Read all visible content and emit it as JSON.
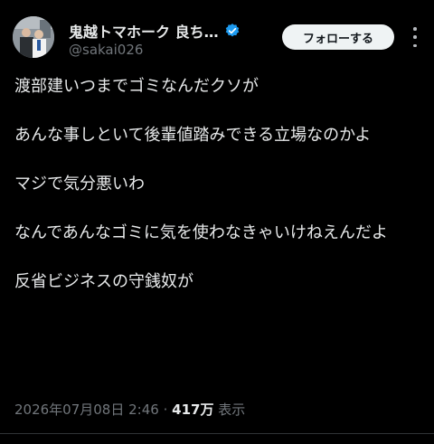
{
  "author": {
    "display_name": "鬼越トマホーク 良ち…",
    "handle": "@sakai026",
    "verified": true,
    "verified_icon": "verified-badge-icon",
    "avatar_icon": "profile-photo"
  },
  "actions": {
    "follow_label": "フォローする",
    "more_icon": "more-vertical-icon"
  },
  "post": {
    "paragraphs": [
      "渡部建いつまでゴミなんだクソが",
      "あんな事しといて後輩値踏みできる立場なのかよ",
      "マジで気分悪いわ",
      "なんであんなゴミに気を使わなきゃいけねえんだよ",
      "反省ビジネスの守銭奴が"
    ],
    "timestamp": "2026年07月08日 2:46",
    "separator": "·",
    "views_count": "417万",
    "views_label": "表示"
  },
  "colors": {
    "background": "#000000",
    "text": "#e7e9ea",
    "secondary": "#71767b",
    "verified": "#1d9bf0",
    "button_bg": "#eff3f4"
  }
}
